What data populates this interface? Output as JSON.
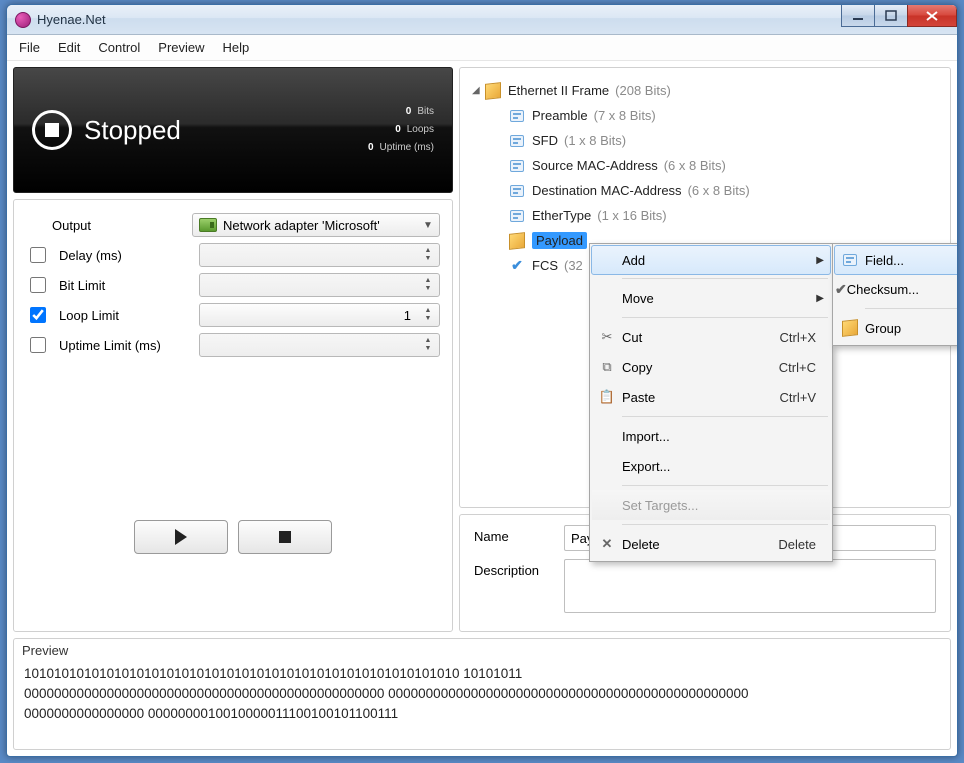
{
  "window": {
    "title": "Hyenae.Net"
  },
  "menu": {
    "file": "File",
    "edit": "Edit",
    "control": "Control",
    "preview": "Preview",
    "help": "Help"
  },
  "status": {
    "label": "Stopped",
    "bits_n": "0",
    "bits_l": "Bits",
    "loops_n": "0",
    "loops_l": "Loops",
    "uptime_n": "0",
    "uptime_l": "Uptime (ms)"
  },
  "form": {
    "output_label": "Output",
    "output_value": "Network adapter 'Microsoft'",
    "delay_label": "Delay (ms)",
    "bitlimit_label": "Bit Limit",
    "looplimit_label": "Loop Limit",
    "looplimit_value": "1",
    "uptimelimit_label": "Uptime Limit (ms)"
  },
  "tree": {
    "root_label": "Ethernet II Frame",
    "root_meta": "(208 Bits)",
    "items": [
      {
        "label": "Preamble",
        "meta": "(7 x 8 Bits)"
      },
      {
        "label": "SFD",
        "meta": "(1 x 8 Bits)"
      },
      {
        "label": "Source MAC-Address",
        "meta": "(6 x 8 Bits)"
      },
      {
        "label": "Destination MAC-Address",
        "meta": "(6 x 8 Bits)"
      },
      {
        "label": "EtherType",
        "meta": "(1 x 16 Bits)"
      },
      {
        "label": "Payload",
        "meta": ""
      },
      {
        "label": "FCS",
        "meta": "(32"
      }
    ]
  },
  "details": {
    "name_label": "Name",
    "name_value": "Payl",
    "desc_label": "Description"
  },
  "ctx": {
    "add": "Add",
    "move": "Move",
    "cut": "Cut",
    "cut_sc": "Ctrl+X",
    "copy": "Copy",
    "copy_sc": "Ctrl+C",
    "paste": "Paste",
    "paste_sc": "Ctrl+V",
    "import": "Import...",
    "export": "Export...",
    "settargets": "Set Targets...",
    "delete": "Delete",
    "delete_sc": "Delete",
    "sub_field": "Field...",
    "sub_checksum": "Checksum...",
    "sub_group": "Group"
  },
  "preview": {
    "label": "Preview",
    "line1": "1010101010101010101010101010101010101010101010101010101010  10101011",
    "line2": "000000000000000000000000000000000000000000000000  000000000000000000000000000000000000000000000000",
    "line3": "0000000000000000  0000000010010000011100100101100111"
  }
}
